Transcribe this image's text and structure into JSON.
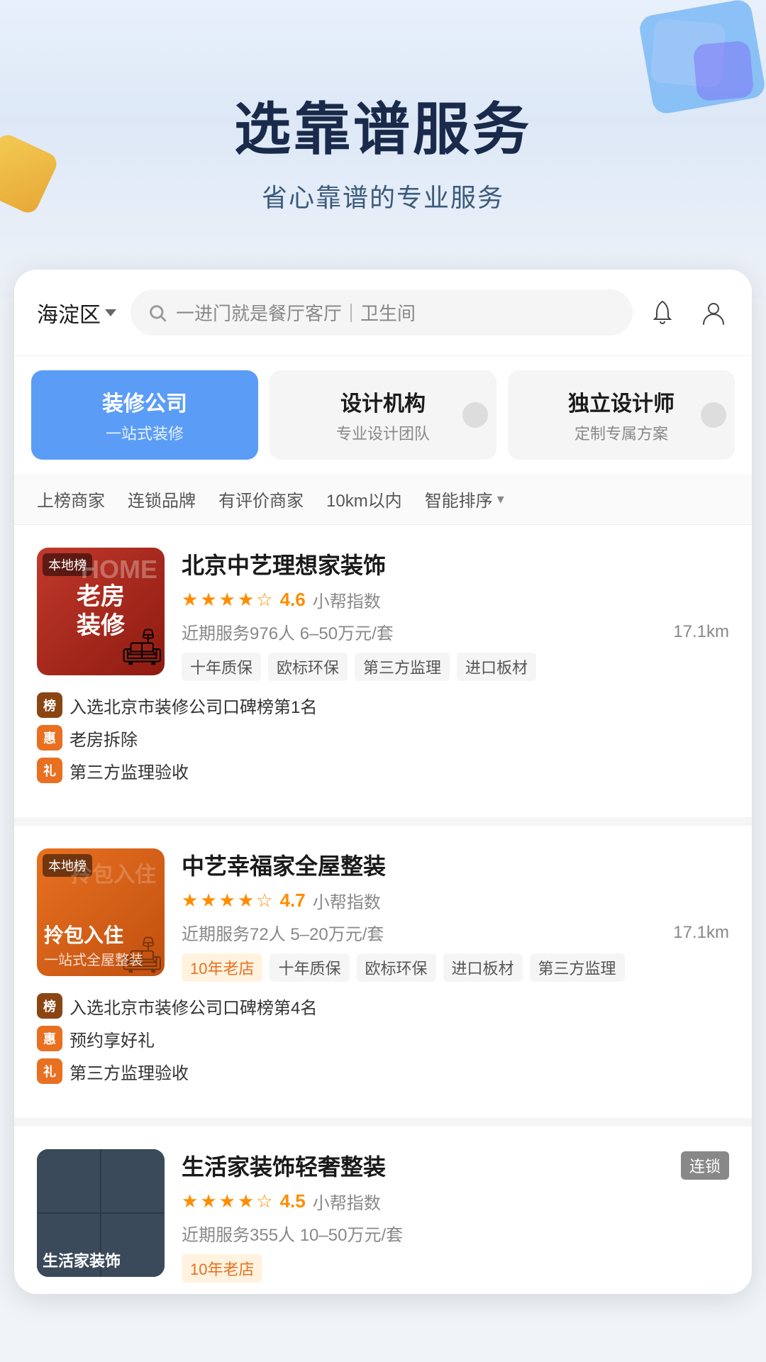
{
  "hero": {
    "title": "选靠谱服务",
    "subtitle": "省心靠谱的专业服务"
  },
  "search": {
    "location": "海淀区",
    "query": "一进门就是餐厅客厅｜卫生间",
    "placeholder": "一进门就是餐厅客厅｜卫生间"
  },
  "categories": [
    {
      "id": "decoration",
      "title": "装修公司",
      "subtitle": "一站式装修",
      "active": true
    },
    {
      "id": "design",
      "title": "设计机构",
      "subtitle": "专业设计团队",
      "active": false
    },
    {
      "id": "designer",
      "title": "独立设计师",
      "subtitle": "定制专属方案",
      "active": false
    }
  ],
  "filters": [
    "上榜商家",
    "连锁品牌",
    "有评价商家",
    "10km以内",
    "智能排序"
  ],
  "listings": [
    {
      "name": "北京中艺理想家装饰",
      "rating": "4.6",
      "ratingLabel": "小帮指数",
      "serviceCount": "近期服务976人",
      "priceRange": "6–50万元/套",
      "distance": "17.1km",
      "tags": [
        "十年质保",
        "欧标环保",
        "第三方监理",
        "进口板材"
      ],
      "badges": [
        {
          "type": "bang",
          "text": "入选北京市装修公司口碑榜第1名"
        },
        {
          "type": "hui",
          "text": "老房拆除"
        },
        {
          "type": "li",
          "text": "第三方监理验收"
        }
      ],
      "thumbType": "1"
    },
    {
      "name": "中艺幸福家全屋整装",
      "rating": "4.7",
      "ratingLabel": "小帮指数",
      "serviceCount": "近期服务72人",
      "priceRange": "5–20万元/套",
      "distance": "17.1km",
      "tags": [
        "10年老店",
        "十年质保",
        "欧标环保",
        "进口板材",
        "第三方监理"
      ],
      "badges": [
        {
          "type": "bang",
          "text": "入选北京市装修公司口碑榜第4名"
        },
        {
          "type": "hui",
          "text": "预约享好礼"
        },
        {
          "type": "li",
          "text": "第三方监理验收"
        }
      ],
      "thumbType": "2"
    },
    {
      "name": "生活家装饰轻奢整装",
      "rating": "4.5",
      "ratingLabel": "小帮指数",
      "serviceCount": "近期服务355人",
      "priceRange": "10–50万元/套",
      "distance": "",
      "tags": [
        "10年老店"
      ],
      "badges": [],
      "thumbType": "3",
      "chain": true
    }
  ],
  "labels": {
    "locationChevron": "▾",
    "filterSort": "智能排序",
    "chainBadge": "连锁",
    "bangIcon": "榜",
    "huiIcon": "惠",
    "liIcon": "礼",
    "localBadge": "本地榜"
  }
}
